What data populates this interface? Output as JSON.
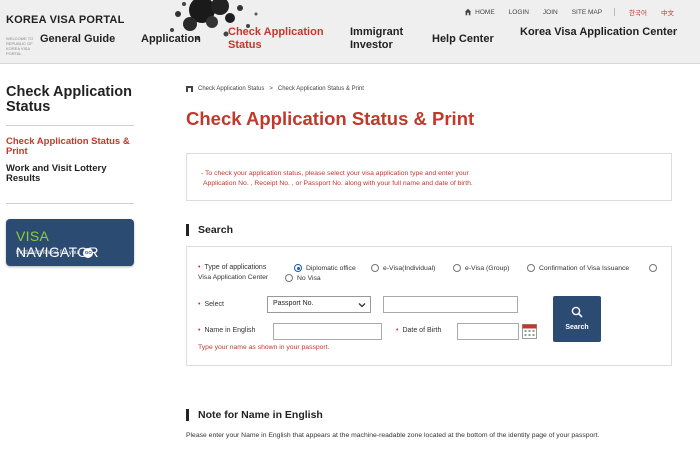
{
  "header": {
    "logo_title": "KOREA VISA PORTAL",
    "logo_sub": "WELCOME TO REPUBLIC OF KOREA VISA PORTAL",
    "util_links": [
      {
        "label": "HOME"
      },
      {
        "label": "LOGIN"
      },
      {
        "label": "JOIN"
      },
      {
        "label": "SITE MAP"
      },
      {
        "label": "한국어"
      },
      {
        "label": "中文"
      }
    ],
    "nav": [
      {
        "label": "General Guide"
      },
      {
        "label": "Application"
      },
      {
        "label": "Check Application Status"
      },
      {
        "label": "Immigrant Investor"
      },
      {
        "label": "Help Center"
      },
      {
        "label": "Korea Visa Application Center"
      }
    ]
  },
  "sidebar": {
    "title": "Check Application Status",
    "items": [
      {
        "label": "Check Application Status & Print"
      },
      {
        "label": "Work and Visit Lottery Results"
      }
    ],
    "banner": {
      "title_a": "VISA",
      "title_b": "NAVIGATOR",
      "subtitle": "Find a right visa for you",
      "badge": "GO"
    }
  },
  "breadcrumb": [
    "Check Application Status",
    "Check Application Status & Print"
  ],
  "page_title": "Check Application Status & Print",
  "info": {
    "line1": "- To check your application status, please select your visa application type and enter your",
    "line2": "Application No. , Receipt No. , or Passport No. along with your full name and date of birth."
  },
  "search": {
    "title": "Search",
    "type_label": "Type of applications",
    "types": [
      {
        "label": "Diplomatic office",
        "selected": true
      },
      {
        "label": "e-Visa(Individual)",
        "selected": false
      },
      {
        "label": "e-Visa (Group)",
        "selected": false
      },
      {
        "label": "Confirmation of Visa Issuance",
        "selected": false
      },
      {
        "label": "Visa Application Center",
        "selected": false
      },
      {
        "label": "No Visa",
        "selected": false
      }
    ],
    "select_label": "Select",
    "select_value": "Passport No.",
    "name_label": "Name in English",
    "dob_label": "Date of Birth",
    "button_label": "Search",
    "hint": "Type your name as shown in your passport."
  },
  "note": {
    "title": "Note for Name in English",
    "text": "Please enter your Name in English that appears at the machine-readable zone located at the bottom of the identity page of your passport."
  },
  "colors": {
    "accent": "#c0392b",
    "navy": "#2c4b73",
    "header_bg": "#efefef"
  }
}
